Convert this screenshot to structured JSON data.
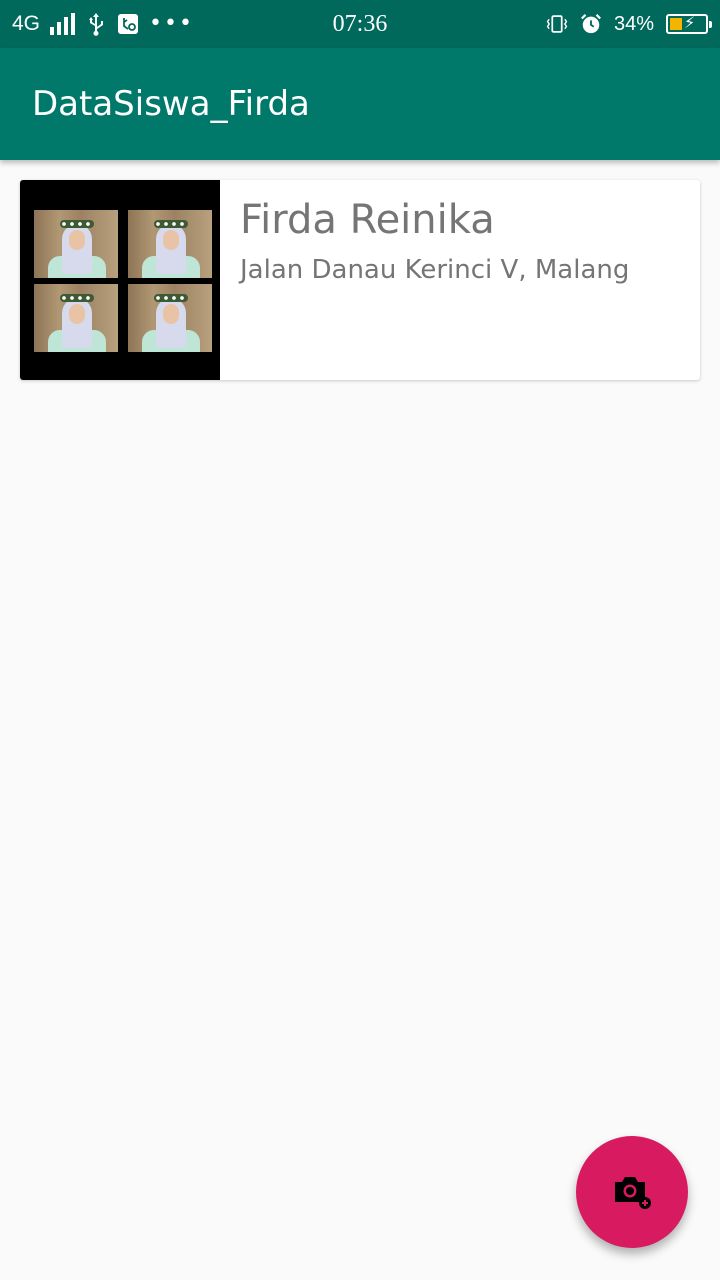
{
  "status_bar": {
    "network": "4G",
    "time": "07:36",
    "battery_percent": "34%",
    "battery_level": 0.34,
    "icons": [
      "signal-icon",
      "usb-icon",
      "usb-debug-icon",
      "more-notifications-icon",
      "vibrate-icon",
      "alarm-icon",
      "battery-charging-icon"
    ]
  },
  "app_bar": {
    "title": "DataSiswa_Firda"
  },
  "students": [
    {
      "name": "Firda Reinika",
      "address": "Jalan Danau Kerinci V, Malang",
      "photo": "student-photo-collage"
    }
  ],
  "fab": {
    "icon": "add-a-photo-icon",
    "color": "#d81b60"
  },
  "colors": {
    "status_bar": "#00695c",
    "app_bar": "#00796b",
    "background": "#fafafa",
    "card_text": "#757575",
    "accent": "#d81b60"
  }
}
